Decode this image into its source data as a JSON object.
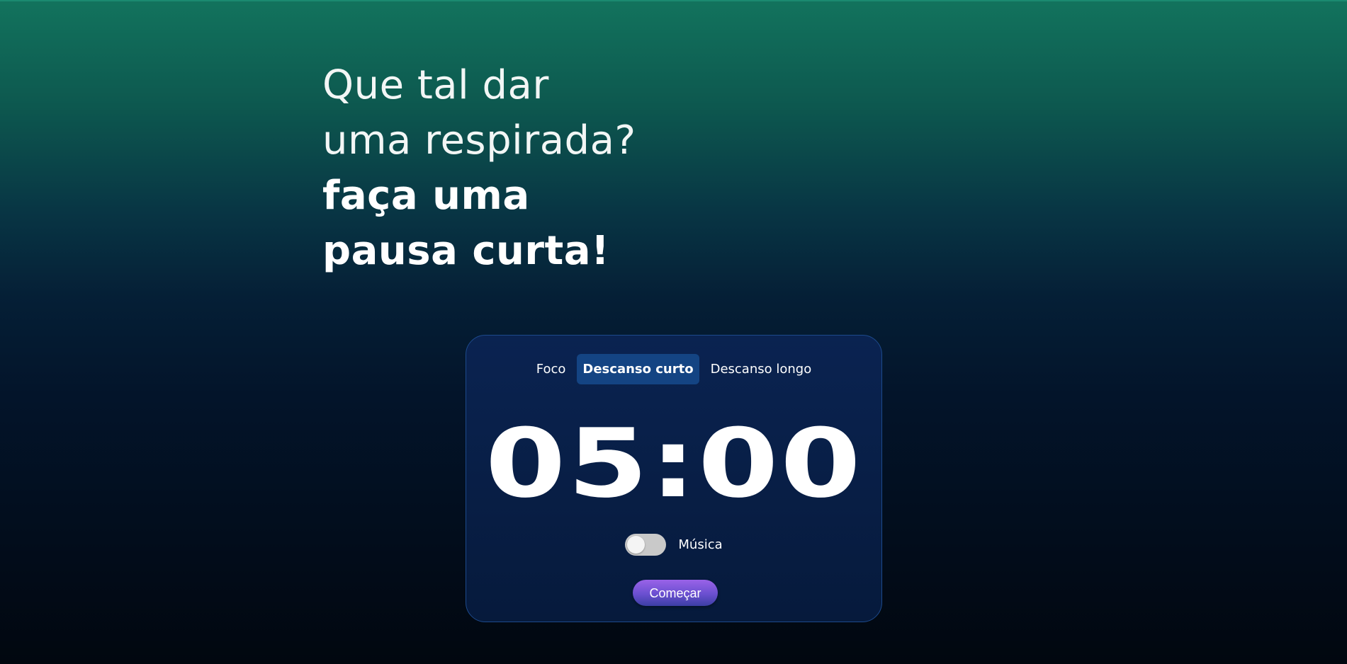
{
  "headline": {
    "line1": "Que tal dar",
    "line2": "uma respirada?",
    "line3": "faça uma",
    "line4": "pausa curta!"
  },
  "tabs": [
    {
      "label": "Foco",
      "active": false
    },
    {
      "label": "Descanso curto",
      "active": true
    },
    {
      "label": "Descanso longo",
      "active": false
    }
  ],
  "timer": {
    "display": "05:00"
  },
  "music": {
    "label": "Música",
    "enabled": false
  },
  "start_button": {
    "label": "Começar"
  },
  "colors": {
    "active_tab_bg": "#144483",
    "card_border": "#1d4a8c",
    "button_gradient_top": "#9a63e8",
    "button_gradient_bottom": "#3c3fa4"
  }
}
